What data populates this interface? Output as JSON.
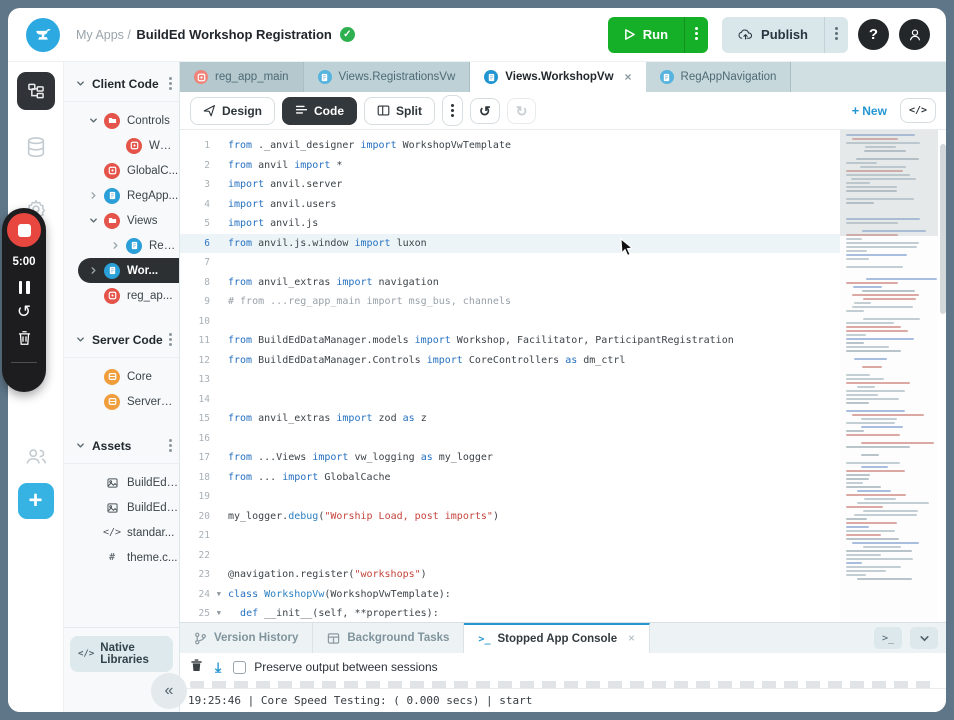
{
  "header": {
    "breadcrumb_prefix": "My Apps /",
    "app_title": "BuildEd Workshop Registration",
    "run_label": "Run",
    "publish_label": "Publish",
    "help_label": "?",
    "accent_green": "#16b028",
    "publish_bg": "#d9e6ea"
  },
  "rail": {
    "icons": [
      "app-structure-icon",
      "database-icon",
      "settings-gear-icon",
      "users-icon",
      "add-plus-icon"
    ]
  },
  "timer": {
    "time": "5:00",
    "icons": [
      "stop-icon",
      "pause-icon",
      "restart-icon",
      "trash-icon"
    ]
  },
  "explorer": {
    "sections": [
      {
        "title": "Client Code",
        "items": [
          {
            "label": "Controls",
            "icon": "folder",
            "color": "#e4544a",
            "depth": 1,
            "expander": "down"
          },
          {
            "label": "WCo...",
            "icon": "module",
            "color": "#e4544a",
            "depth": 2
          },
          {
            "label": "GlobalC...",
            "icon": "module",
            "color": "#e4544a",
            "depth": 1
          },
          {
            "label": "RegApp...",
            "icon": "form",
            "color": "#2b9fd8",
            "depth": 1,
            "expander": "right"
          },
          {
            "label": "Views",
            "icon": "folder",
            "color": "#e4544a",
            "depth": 1,
            "expander": "down"
          },
          {
            "label": "Regi...",
            "icon": "form",
            "color": "#2b9fd8",
            "depth": 2,
            "expander": "right"
          },
          {
            "label": "Wor...",
            "icon": "form",
            "color": "#2b9fd8",
            "depth": 2,
            "expander": "right",
            "selected": true
          },
          {
            "label": "reg_ap...",
            "icon": "module",
            "color": "#e4544a",
            "depth": 1
          }
        ]
      },
      {
        "title": "Server Code",
        "items": [
          {
            "label": "Core",
            "icon": "server",
            "color": "#f09d3c",
            "depth": 1
          },
          {
            "label": "ServerM...",
            "icon": "server",
            "color": "#f09d3c",
            "depth": 1
          }
        ]
      },
      {
        "title": "Assets",
        "items": [
          {
            "label": "BuildEd-l...",
            "icon": "image",
            "depth": 1
          },
          {
            "label": "BuildEd-l...",
            "icon": "image",
            "depth": 1
          },
          {
            "label": "standar...",
            "icon": "code",
            "depth": 1
          },
          {
            "label": "theme.c...",
            "icon": "hash",
            "depth": 1
          }
        ]
      }
    ],
    "native_libraries_label": "Native Libraries"
  },
  "tabs": [
    {
      "label": "reg_app_main",
      "icon": "module-tab-icon",
      "icon_color": "#ef8379",
      "bg": "#b4c8ce"
    },
    {
      "label": "Views.RegistrationsVw",
      "icon": "form-tab-icon",
      "icon_color": "#56b4de",
      "bg": "#bdd1d6"
    },
    {
      "label": "Views.WorkshopVw",
      "icon": "form-tab-icon",
      "icon_color": "#2196d3",
      "active": true,
      "closable": true
    },
    {
      "label": "RegAppNavigation",
      "icon": "form-tab-icon",
      "icon_color": "#56b4de",
      "bg": "#c6d8dc"
    }
  ],
  "toolbar": {
    "design_label": "Design",
    "code_label": "Code",
    "split_label": "Split",
    "new_label": "New",
    "code_toggle_label": "</>"
  },
  "editor": {
    "active_line": 6,
    "fold_lines": [
      24,
      25
    ],
    "lines": [
      [
        [
          "k",
          "from"
        ],
        [
          "p",
          " ._anvil_designer "
        ],
        [
          "k",
          "import"
        ],
        [
          "p",
          " WorkshopVwTemplate"
        ]
      ],
      [
        [
          "k",
          "from"
        ],
        [
          "p",
          " anvil "
        ],
        [
          "k",
          "import"
        ],
        [
          "p",
          " *"
        ]
      ],
      [
        [
          "k",
          "import"
        ],
        [
          "p",
          " anvil.server"
        ]
      ],
      [
        [
          "k",
          "import"
        ],
        [
          "p",
          " anvil.users"
        ]
      ],
      [
        [
          "k",
          "import"
        ],
        [
          "p",
          " anvil.js"
        ]
      ],
      [
        [
          "k",
          "from"
        ],
        [
          "p",
          " anvil.js.window "
        ],
        [
          "k",
          "import"
        ],
        [
          "p",
          " luxon"
        ]
      ],
      [],
      [
        [
          "k",
          "from"
        ],
        [
          "p",
          " anvil_extras "
        ],
        [
          "k",
          "import"
        ],
        [
          "p",
          " navigation"
        ]
      ],
      [
        [
          "c",
          "# from ...reg_app_main import msg_bus, channels"
        ]
      ],
      [],
      [
        [
          "k",
          "from"
        ],
        [
          "p",
          " BuildEdDataManager.models "
        ],
        [
          "k",
          "import"
        ],
        [
          "p",
          " Workshop, Facilitator, ParticipantRegistration"
        ]
      ],
      [
        [
          "k",
          "from"
        ],
        [
          "p",
          " BuildEdDataManager.Controls "
        ],
        [
          "k",
          "import"
        ],
        [
          "p",
          " CoreControllers "
        ],
        [
          "k",
          "as"
        ],
        [
          "p",
          " dm_ctrl"
        ]
      ],
      [],
      [],
      [
        [
          "k",
          "from"
        ],
        [
          "p",
          " anvil_extras "
        ],
        [
          "k",
          "import"
        ],
        [
          "p",
          " zod "
        ],
        [
          "k",
          "as"
        ],
        [
          "p",
          " z"
        ]
      ],
      [],
      [
        [
          "k",
          "from"
        ],
        [
          "p",
          " ...Views "
        ],
        [
          "k",
          "import"
        ],
        [
          "p",
          " vw_logging "
        ],
        [
          "k",
          "as"
        ],
        [
          "p",
          " my_logger"
        ]
      ],
      [
        [
          "k",
          "from"
        ],
        [
          "p",
          " ... "
        ],
        [
          "k",
          "import"
        ],
        [
          "p",
          " GlobalCache"
        ]
      ],
      [],
      [
        [
          "p",
          "my_logger."
        ],
        [
          "f",
          "debug"
        ],
        [
          "p",
          "("
        ],
        [
          "s",
          "\"Worship Load, post imports\""
        ],
        [
          "p",
          ")"
        ]
      ],
      [],
      [],
      [
        [
          "p",
          "@navigation.register("
        ],
        [
          "s",
          "\"workshops\""
        ],
        [
          "p",
          ")"
        ]
      ],
      [
        [
          "k",
          "class"
        ],
        [
          "f",
          " WorkshopVw"
        ],
        [
          "p",
          "(WorkshopVwTemplate):"
        ]
      ],
      [
        [
          "p",
          "  "
        ],
        [
          "k",
          "def"
        ],
        [
          "p",
          " __init__(self, **properties):"
        ]
      ]
    ]
  },
  "console": {
    "tabs": [
      {
        "label": "Version History",
        "icon": "git-branch-icon"
      },
      {
        "label": "Background Tasks",
        "icon": "tasks-grid-icon"
      },
      {
        "label": "Stopped App Console",
        "icon": "terminal-icon",
        "active": true,
        "closable": true
      }
    ],
    "terminal_button_label": ">_",
    "preserve_label": "Preserve output between sessions",
    "output": "19:25:46 | Core Speed Testing: ( 0.000 secs) | start"
  }
}
